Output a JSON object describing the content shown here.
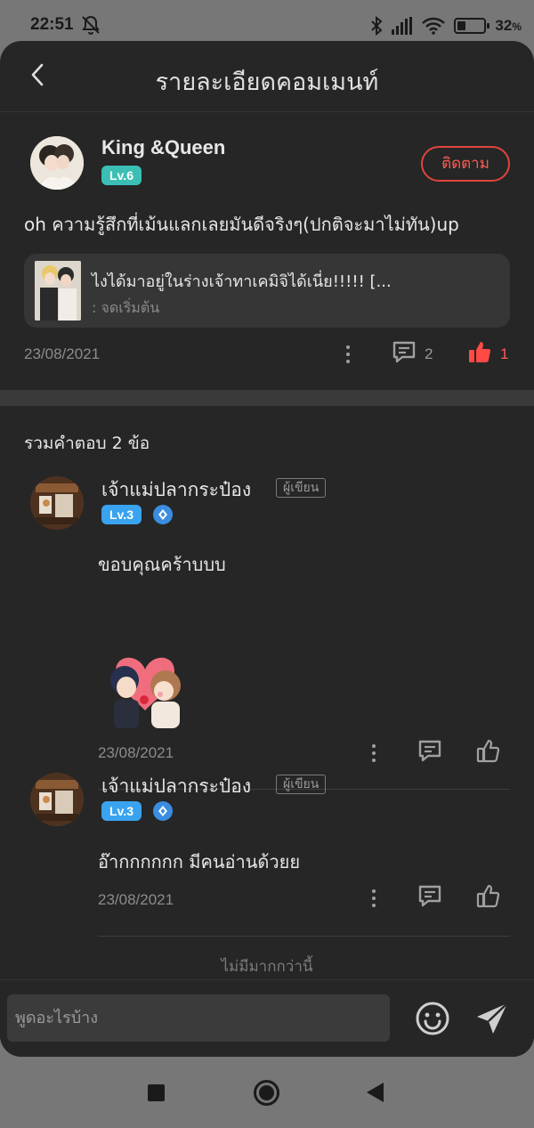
{
  "status_bar": {
    "time": "22:51",
    "battery_percent": "32",
    "battery_level": 0.32,
    "icons": [
      "bell-off-icon",
      "bluetooth-icon",
      "signal-icon",
      "wifi-icon",
      "battery-icon"
    ]
  },
  "header": {
    "title": "รายละเอียดคอมเมนท์"
  },
  "main_comment": {
    "username": "King &Queen",
    "level": "Lv.6",
    "follow_label": "ติดตาม",
    "text": "oh ความรู้สึกที่เม้นแลกเลยมันดีจริงๆ(ปกติจะมาไม่ทัน)up",
    "reference": {
      "title": "ไงได้มาอยู่ในร่างเจ้าทาเคมิจิได้เนี่ย!!!!! [...",
      "subtitle": ": จดเริ่มต้น"
    },
    "date": "23/08/2021",
    "reply_count": "2",
    "like_count": "1"
  },
  "replies": {
    "heading": "รวมคำตอบ 2 ข้อ",
    "items": [
      {
        "username": "เจ้าแม่ปลากระป๋อง",
        "author_tag": "ผู้เขียน",
        "level": "Lv.3",
        "text": "ขอบคุณคร้าบบบ",
        "has_sticker": true,
        "date": "23/08/2021"
      },
      {
        "username": "เจ้าแม่ปลากระป๋อง",
        "author_tag": "ผู้เขียน",
        "level": "Lv.3",
        "text": "อ๊ากกกกกก มีคนอ่านด้วยย",
        "has_sticker": false,
        "date": "23/08/2021"
      }
    ],
    "end_text": "ไม่มีมากกว่านี้"
  },
  "input": {
    "placeholder": "พูดอะไรบ้าง",
    "value": ""
  },
  "colors": {
    "accent_red": "#ff5a52",
    "level_teal": "#3bbfb5",
    "level_blue": "#3aa3f0",
    "background": "#262626"
  }
}
